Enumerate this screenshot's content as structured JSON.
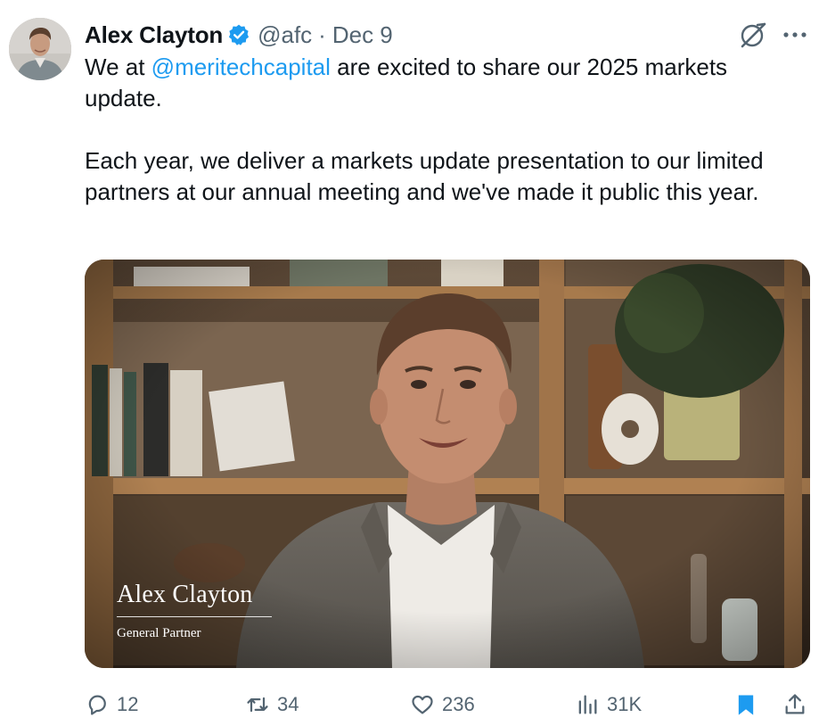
{
  "author": {
    "name": "Alex Clayton",
    "handle": "@afc",
    "separator": "·",
    "date": "Dec 9",
    "verified_icon": "verified-badge-icon",
    "accent": "#1d9bf0"
  },
  "tweet": {
    "line1_prefix": "We at ",
    "mention": "@meritechcapital",
    "line1_suffix": " are excited to share our 2025 markets update.",
    "paragraph2": "Each year, we deliver a markets update presentation to our limited partners at our annual meeting and we've made it public this year."
  },
  "media": {
    "lower_third_name": "Alex Clayton",
    "lower_third_title": "General Partner"
  },
  "actions": {
    "replies": "12",
    "reposts": "34",
    "likes": "236",
    "views": "31K"
  },
  "icons": [
    "grok-icon",
    "more-icon",
    "reply-icon",
    "repost-icon",
    "like-icon",
    "views-icon",
    "bookmark-icon",
    "share-icon"
  ]
}
